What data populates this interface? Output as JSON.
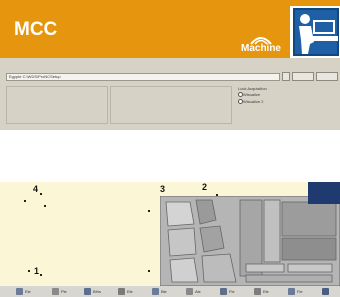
{
  "header": {
    "title": "MCC",
    "badge_label": "Machine",
    "accent_color": "#e6950f",
    "operator_icon": "machine-operator-icon"
  },
  "dialog": {
    "path_value": "Egypte C:\\WDS\\ProNCSetup"
  },
  "radio": {
    "group_label": "Lock Acquisition",
    "option1": "Wisualize",
    "option2": "Wisualize 2"
  },
  "markers": {
    "m1": "1",
    "m2": "2",
    "m3": "3",
    "m4": "4"
  },
  "taskbar": {
    "items": [
      {
        "label": "Ele"
      },
      {
        "label": "Ple"
      },
      {
        "label": "BHa"
      },
      {
        "label": "Ele"
      },
      {
        "label": "Ble"
      },
      {
        "label": "Ale"
      },
      {
        "label": "Fle"
      },
      {
        "label": "Ele"
      },
      {
        "label": "Fle"
      }
    ]
  }
}
